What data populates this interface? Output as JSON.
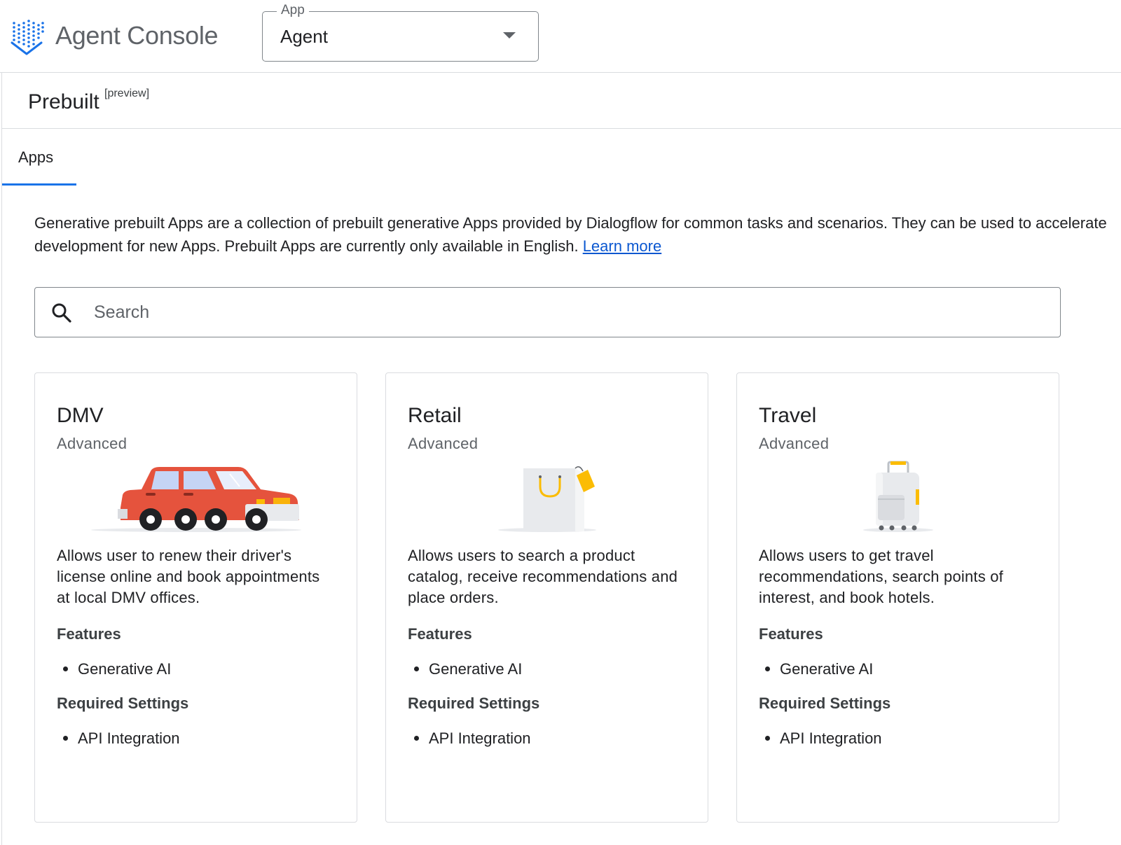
{
  "header": {
    "app_title": "Agent Console",
    "app_select": {
      "label": "App",
      "value": "Agent"
    }
  },
  "page": {
    "title": "Prebuilt",
    "title_sup": "[preview]"
  },
  "tabs": [
    {
      "label": "Apps",
      "active": true
    }
  ],
  "intro": {
    "text": "Generative prebuilt Apps are a collection of prebuilt generative Apps provided by Dialogflow for common tasks and scenarios. They can be used to accelerate development for new Apps. Prebuilt Apps are currently only available in English.",
    "link": "Learn more"
  },
  "search": {
    "placeholder": "Search"
  },
  "cards": [
    {
      "title": "DMV",
      "level": "Advanced",
      "illustration": "car-illustration",
      "description": "Allows user to renew their driver's license online and book appointments at local DMV offices.",
      "features_heading": "Features",
      "features": [
        "Generative AI"
      ],
      "settings_heading": "Required Settings",
      "settings": [
        "API Integration"
      ]
    },
    {
      "title": "Retail",
      "level": "Advanced",
      "illustration": "shopping-bag-illustration",
      "description": "Allows users to search a product catalog, receive recommendations and place orders.",
      "features_heading": "Features",
      "features": [
        "Generative AI"
      ],
      "settings_heading": "Required Settings",
      "settings": [
        "API Integration"
      ]
    },
    {
      "title": "Travel",
      "level": "Advanced",
      "illustration": "suitcase-illustration",
      "description": "Allows users to get travel recommendations, search points of interest, and book hotels.",
      "features_heading": "Features",
      "features": [
        "Generative AI"
      ],
      "settings_heading": "Required Settings",
      "settings": [
        "API Integration"
      ]
    }
  ],
  "colors": {
    "accent": "#1a73e8",
    "link": "#0b57d0",
    "border": "#dadce0",
    "muted_text": "#5f6368",
    "car_red": "#e5533d",
    "bag_yellow": "#fbbc04"
  }
}
